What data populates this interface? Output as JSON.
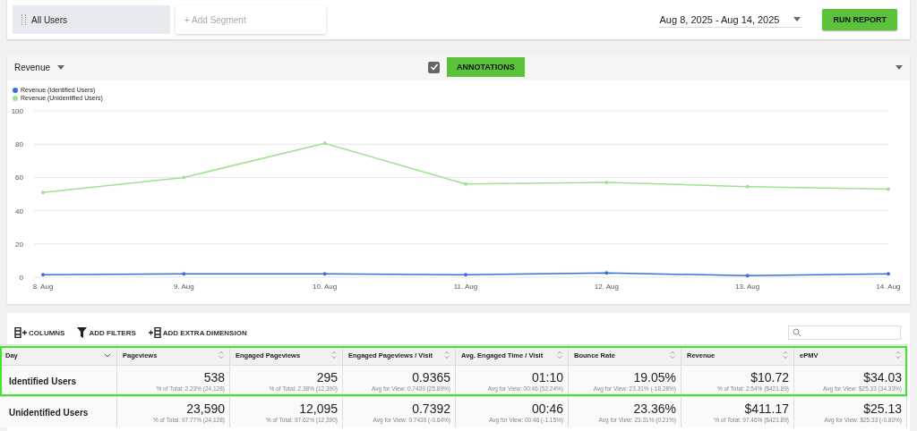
{
  "segments": [
    {
      "label": "All Users",
      "kind": "segment"
    },
    {
      "label": "+ Add Segment",
      "kind": "add"
    }
  ],
  "date_range": "Aug 8, 2025 - Aug 14, 2025",
  "run_button": "RUN REPORT",
  "chart_panel": {
    "metric": "Revenue",
    "annotations_checked": true,
    "annotations_button": "ANNOTATIONS",
    "chart_data": {
      "type": "line",
      "grid": true,
      "legend": true,
      "x": [
        "8. Aug",
        "9. Aug",
        "10. Aug",
        "11. Aug",
        "12. Aug",
        "13. Aug",
        "14. Aug"
      ],
      "ylim": [
        0,
        100
      ],
      "yticks": [
        0,
        20,
        40,
        60,
        80,
        100
      ],
      "series": [
        {
          "name": "Revenue (Identified Users)",
          "color": "#3b6fd8",
          "values": [
            1.5,
            2,
            2,
            1.5,
            2.5,
            1,
            2
          ]
        },
        {
          "name": "Revenue (Unidentified Users)",
          "color": "#9be38f",
          "values": [
            51,
            60,
            80.5,
            56,
            57,
            54.5,
            53
          ]
        }
      ]
    }
  },
  "toolbar": [
    "COLUMNS",
    "ADD FILTERS",
    "ADD EXTRA DIMENSION"
  ],
  "table": {
    "columns": [
      "Day",
      "Pageviews",
      "Engaged Pageviews",
      "Engaged Pageviews / Visit",
      "Avg. Engaged Time / Visit",
      "Bounce Rate",
      "Revenue",
      "ePMV"
    ],
    "rows": [
      {
        "highlighted": true,
        "cells": [
          {
            "kind": "label",
            "value": "Identified Users"
          },
          {
            "value": "538",
            "sub": "% of Total: 2.23% (24,128)"
          },
          {
            "value": "295",
            "sub": "% of Total: 2.38% (12,390)"
          },
          {
            "value": "0.9365",
            "sub": "Avg for View: 0.7439 (25.89%)"
          },
          {
            "value": "01:10",
            "sub": "Avg for View: 00:46 (52.24%)"
          },
          {
            "value": "19.05%",
            "sub": "Avg for View: 23.31% (-18.28%)"
          },
          {
            "value": "$10.72",
            "sub": "% of Total: 2.54% ($421.89)"
          },
          {
            "value": "$34.03",
            "sub": "Avg for View: $25.33 (34.33%)"
          }
        ]
      },
      {
        "highlighted": false,
        "cells": [
          {
            "kind": "label",
            "value": "Unidentified Users"
          },
          {
            "value": "23,590",
            "sub": "% of Total: 97.77% (24,128)"
          },
          {
            "value": "12,095",
            "sub": "% of Total: 97.62% (12,390)"
          },
          {
            "value": "0.7392",
            "sub": "Avg for View: 0.7439 (-0.64%)"
          },
          {
            "value": "00:46",
            "sub": "Avg for View: 00:46 (-1.15%)"
          },
          {
            "value": "23.36%",
            "sub": "Avg for View: 23.31% (0.21%)"
          },
          {
            "value": "$411.17",
            "sub": "% of Total: 97.46% ($421.89)"
          },
          {
            "value": "$25.13",
            "sub": "Avg for View: $25.33 (-0.80%)"
          }
        ]
      }
    ]
  }
}
